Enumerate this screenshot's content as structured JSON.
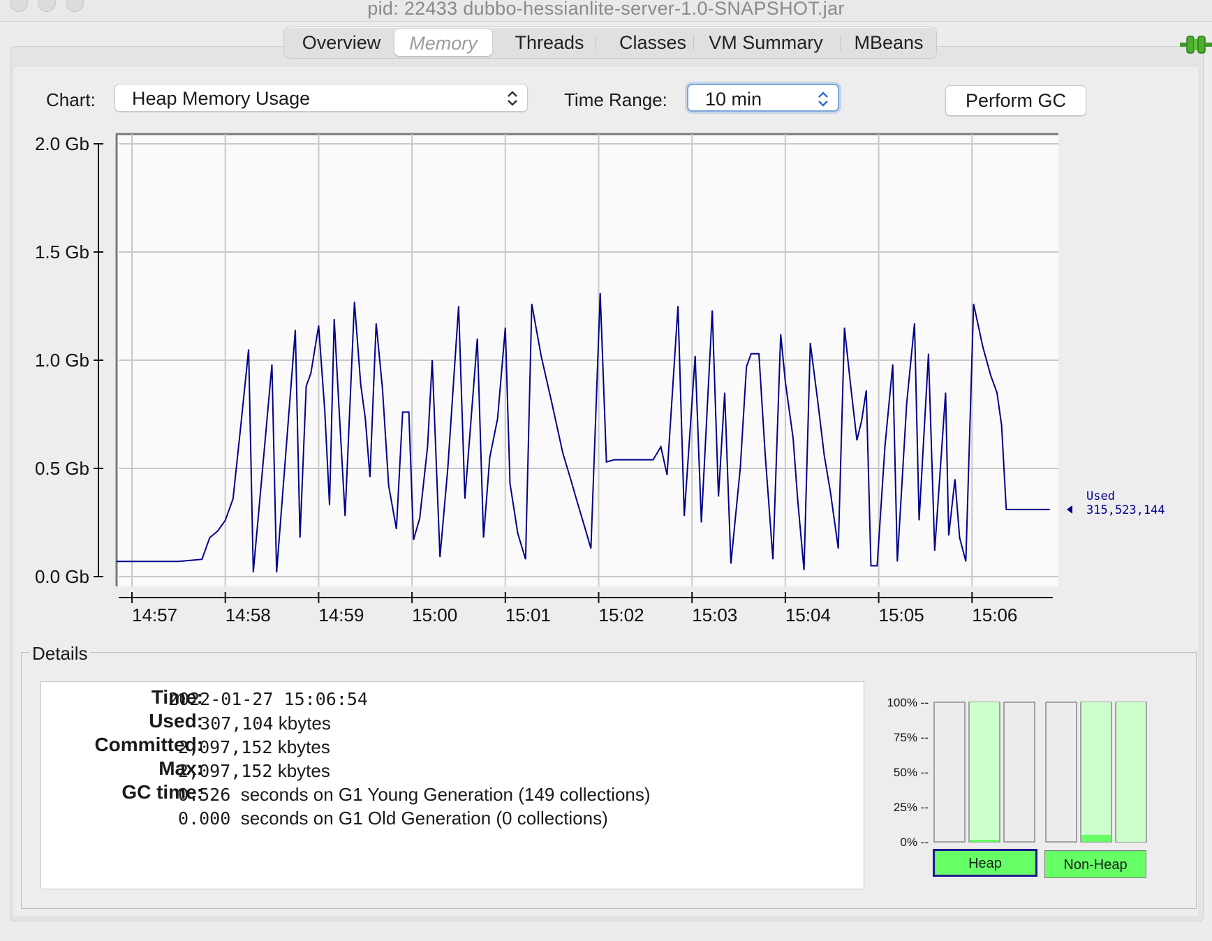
{
  "window": {
    "title": "pid: 22433 dubbo-hessianlite-server-1.0-SNAPSHOT.jar"
  },
  "tabs": [
    {
      "label": "Overview"
    },
    {
      "label": "Memory"
    },
    {
      "label": "Threads"
    },
    {
      "label": "Classes"
    },
    {
      "label": "VM Summary"
    },
    {
      "label": "MBeans"
    }
  ],
  "toolbar": {
    "chart_label": "Chart:",
    "chart_value": "Heap Memory Usage",
    "time_range_label": "Time Range:",
    "time_range_value": "10 min",
    "gc_button": "Perform GC"
  },
  "chart_data": {
    "type": "line",
    "title": "",
    "xlabel": "",
    "ylabel": "",
    "ylim": [
      0,
      2.0
    ],
    "xlim": [
      "14:56:50",
      "15:06:54"
    ],
    "y_ticks": [
      "0.0 Gb",
      "0.5 Gb",
      "1.0 Gb",
      "1.5 Gb",
      "2.0 Gb"
    ],
    "x_ticks": [
      "14:57",
      "14:58",
      "14:59",
      "15:00",
      "15:01",
      "15:02",
      "15:03",
      "15:04",
      "15:05",
      "15:06"
    ],
    "grid": true,
    "series_color": "#00008b",
    "series": [
      {
        "label_name": "Used",
        "label_value": "315,523,144",
        "points": [
          [
            "14:56:50",
            0.07
          ],
          [
            "14:57:30",
            0.07
          ],
          [
            "14:57:45",
            0.08
          ],
          [
            "14:57:50",
            0.18
          ],
          [
            "14:57:55",
            0.21
          ],
          [
            "14:58:00",
            0.26
          ],
          [
            "14:58:05",
            0.36
          ],
          [
            "14:58:10",
            0.7
          ],
          [
            "14:58:15",
            1.05
          ],
          [
            "14:58:18",
            0.02
          ],
          [
            "14:58:30",
            0.98
          ],
          [
            "14:58:33",
            0.02
          ],
          [
            "14:58:45",
            1.14
          ],
          [
            "14:58:48",
            0.18
          ],
          [
            "14:58:52",
            0.88
          ],
          [
            "14:58:55",
            0.94
          ],
          [
            "14:59:00",
            1.16
          ],
          [
            "14:59:04",
            0.76
          ],
          [
            "14:59:07",
            0.33
          ],
          [
            "14:59:10",
            1.19
          ],
          [
            "14:59:13",
            0.79
          ],
          [
            "14:59:17",
            0.28
          ],
          [
            "14:59:23",
            1.27
          ],
          [
            "14:59:27",
            0.89
          ],
          [
            "14:59:30",
            0.73
          ],
          [
            "14:59:33",
            0.46
          ],
          [
            "14:59:37",
            1.17
          ],
          [
            "14:59:41",
            0.87
          ],
          [
            "14:59:45",
            0.42
          ],
          [
            "14:59:50",
            0.22
          ],
          [
            "14:59:54",
            0.76
          ],
          [
            "14:59:58",
            0.76
          ],
          [
            "15:00:01",
            0.17
          ],
          [
            "15:00:05",
            0.27
          ],
          [
            "15:00:10",
            0.6
          ],
          [
            "15:00:13",
            1.0
          ],
          [
            "15:00:18",
            0.09
          ],
          [
            "15:00:23",
            0.5
          ],
          [
            "15:00:30",
            1.25
          ],
          [
            "15:00:34",
            0.36
          ],
          [
            "15:00:42",
            1.1
          ],
          [
            "15:00:46",
            0.18
          ],
          [
            "15:00:50",
            0.55
          ],
          [
            "15:00:55",
            0.73
          ],
          [
            "15:01:00",
            1.15
          ],
          [
            "15:01:03",
            0.43
          ],
          [
            "15:01:08",
            0.2
          ],
          [
            "15:01:13",
            0.08
          ],
          [
            "15:01:17",
            1.26
          ],
          [
            "15:01:23",
            1.02
          ],
          [
            "15:01:30",
            0.8
          ],
          [
            "15:01:37",
            0.57
          ],
          [
            "15:01:42",
            0.45
          ],
          [
            "15:01:46",
            0.35
          ],
          [
            "15:01:51",
            0.23
          ],
          [
            "15:01:55",
            0.13
          ],
          [
            "15:02:01",
            1.31
          ],
          [
            "15:02:05",
            0.53
          ],
          [
            "15:02:10",
            0.54
          ],
          [
            "15:02:35",
            0.54
          ],
          [
            "15:02:40",
            0.6
          ],
          [
            "15:02:44",
            0.47
          ],
          [
            "15:02:51",
            1.25
          ],
          [
            "15:02:55",
            0.28
          ],
          [
            "15:03:02",
            1.02
          ],
          [
            "15:03:06",
            0.25
          ],
          [
            "15:03:13",
            1.23
          ],
          [
            "15:03:17",
            0.37
          ],
          [
            "15:03:21",
            0.85
          ],
          [
            "15:03:25",
            0.06
          ],
          [
            "15:03:31",
            0.5
          ],
          [
            "15:03:35",
            0.97
          ],
          [
            "15:03:38",
            1.03
          ],
          [
            "15:03:43",
            1.03
          ],
          [
            "15:03:47",
            0.57
          ],
          [
            "15:03:52",
            0.08
          ],
          [
            "15:03:57",
            1.12
          ],
          [
            "15:04:00",
            0.9
          ],
          [
            "15:04:05",
            0.64
          ],
          [
            "15:04:08",
            0.35
          ],
          [
            "15:04:12",
            0.03
          ],
          [
            "15:04:16",
            1.08
          ],
          [
            "15:04:21",
            0.8
          ],
          [
            "15:04:25",
            0.56
          ],
          [
            "15:04:29",
            0.39
          ],
          [
            "15:04:34",
            0.13
          ],
          [
            "15:04:38",
            1.15
          ],
          [
            "15:04:42",
            0.88
          ],
          [
            "15:04:46",
            0.63
          ],
          [
            "15:04:49",
            0.72
          ],
          [
            "15:04:52",
            0.86
          ],
          [
            "15:04:55",
            0.05
          ],
          [
            "15:04:59",
            0.05
          ],
          [
            "15:05:04",
            0.6
          ],
          [
            "15:05:09",
            0.98
          ],
          [
            "15:05:12",
            0.07
          ],
          [
            "15:05:18",
            0.8
          ],
          [
            "15:05:23",
            1.17
          ],
          [
            "15:05:26",
            0.26
          ],
          [
            "15:05:32",
            1.03
          ],
          [
            "15:05:36",
            0.12
          ],
          [
            "15:05:43",
            0.85
          ],
          [
            "15:05:45",
            0.19
          ],
          [
            "15:05:49",
            0.45
          ],
          [
            "15:05:52",
            0.18
          ],
          [
            "15:05:56",
            0.07
          ],
          [
            "15:06:01",
            1.26
          ],
          [
            "15:06:07",
            1.06
          ],
          [
            "15:06:12",
            0.93
          ],
          [
            "15:06:16",
            0.85
          ],
          [
            "15:06:19",
            0.7
          ],
          [
            "15:06:22",
            0.31
          ],
          [
            "15:06:50",
            0.31
          ]
        ]
      }
    ]
  },
  "details": {
    "legend": "Details",
    "time_label": "Time:",
    "time_value": "2022-01-27 15:06:54",
    "used_label": "Used:",
    "used_value": "   307,104",
    "committed_label": "Committed:",
    "committed_value": "2,097,152",
    "max_label": "Max:",
    "max_value": "2,097,152",
    "unit": " kbytes",
    "gc_label": "GC time:",
    "gc_young_time": "0.526",
    "gc_young_text": "  seconds on G1 Young Generation (149 collections)",
    "gc_old_time": "0.000",
    "gc_old_text": "  seconds on G1 Old Generation (0 collections)"
  },
  "pools": {
    "pct_labels": [
      "100% --",
      "75% --",
      "50% --",
      "25% --",
      "0% --"
    ],
    "heap_label": "Heap",
    "nonheap_label": "Non-Heap",
    "fill_color": "#66ff66",
    "light_color": "#ccffcc",
    "bars": [
      {
        "group": "heap",
        "used": 0.0,
        "committed": 0.0
      },
      {
        "group": "heap",
        "used": 0.01,
        "committed": 1.0
      },
      {
        "group": "heap",
        "used": 0.0,
        "committed": 0.0
      },
      {
        "group": "nonheap",
        "used": 0.0,
        "committed": 0.0
      },
      {
        "group": "nonheap",
        "used": 0.05,
        "committed": 1.0
      },
      {
        "group": "nonheap",
        "used": 0.0,
        "committed": 1.0
      }
    ]
  }
}
